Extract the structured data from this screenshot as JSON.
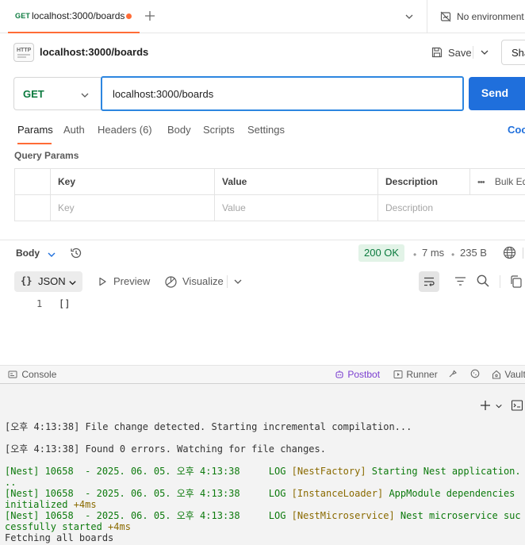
{
  "tab": {
    "method": "GET",
    "title": "localhost:3000/boards"
  },
  "environment": {
    "label": "No environment"
  },
  "request": {
    "name": "localhost:3000/boards",
    "save_label": "Save",
    "share_label": "Share",
    "method": "GET",
    "url": "localhost:3000/boards",
    "send_label": "Send"
  },
  "request_tabs": {
    "params": "Params",
    "auth": "Auth",
    "headers": "Headers (6)",
    "body": "Body",
    "scripts": "Scripts",
    "settings": "Settings",
    "cookies": "Cookies"
  },
  "query_params": {
    "title": "Query Params",
    "headers": {
      "key": "Key",
      "value": "Value",
      "description": "Description",
      "bulk_edit": "Bulk Edit"
    },
    "placeholders": {
      "key": "Key",
      "value": "Value",
      "description": "Description"
    }
  },
  "response": {
    "body_label": "Body",
    "status": "200 OK",
    "time": "7 ms",
    "size": "235 B",
    "format": "JSON",
    "preview_label": "Preview",
    "visualize_label": "Visualize",
    "line_number": "1",
    "content": "[]"
  },
  "status_bar": {
    "console": "Console",
    "postbot": "Postbot",
    "runner": "Runner",
    "vault": "Vault"
  },
  "terminal": {
    "lines": [
      "[오후 4:13:38] File change detected. Starting incremental compilation...",
      "[오후 4:13:38] Found 0 errors. Watching for file changes.",
      {
        "prefix": "[Nest] 10658  - 2025. 06. 05. 오후 4:13:38     LOG ",
        "context": "[NestFactory]",
        "message": " Starting Nest application.",
        "wrap": "..",
        "timing": ""
      },
      {
        "prefix": "[Nest] 10658  - 2025. 06. 05. 오후 4:13:38     LOG ",
        "context": "[InstanceLoader]",
        "message": " AppModule dependencies",
        "wrap": "initialized",
        "timing": " +4ms"
      },
      {
        "prefix": "[Nest] 10658  - 2025. 06. 05. 오후 4:13:38     LOG ",
        "context": "[NestMicroservice]",
        "message": " Nest microservice suc",
        "wrap": "cessfully started",
        "timing": " +4ms"
      },
      "Fetching all boards"
    ]
  },
  "colors": {
    "accent": "#ff6c37",
    "send_button": "#1f6fdc",
    "get_method": "#0b7a3e",
    "status_ok_bg": "#e2f3e7",
    "url_focus": "#2d86e0"
  },
  "icons": [
    "http-request-icon",
    "plus-icon",
    "chevron-down-icon",
    "no-environment-icon",
    "save-icon",
    "history-icon",
    "globe-icon",
    "preview-play-icon",
    "visualize-icon",
    "wrap-lines-icon",
    "filter-icon",
    "search-icon",
    "copy-icon",
    "console-icon",
    "postbot-icon",
    "runner-icon",
    "capture-icon",
    "cookie-icon",
    "vault-icon",
    "terminal-panel-icon"
  ]
}
